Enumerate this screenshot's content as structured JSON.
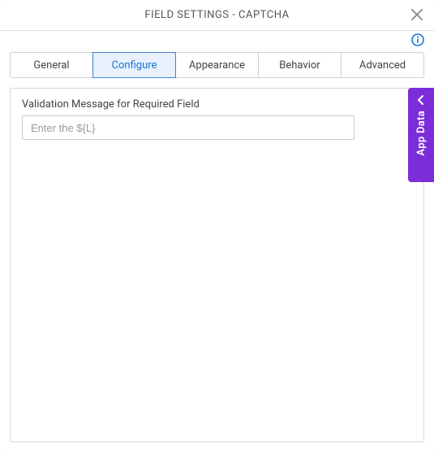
{
  "modal": {
    "title": "FIELD SETTINGS - CAPTCHA"
  },
  "tabs": [
    {
      "label": "General"
    },
    {
      "label": "Configure"
    },
    {
      "label": "Appearance"
    },
    {
      "label": "Behavior"
    },
    {
      "label": "Advanced"
    }
  ],
  "configure": {
    "validation_label": "Validation Message for Required Field",
    "validation_placeholder": "Enter the ${L}"
  },
  "drawer": {
    "label": "App Data"
  }
}
